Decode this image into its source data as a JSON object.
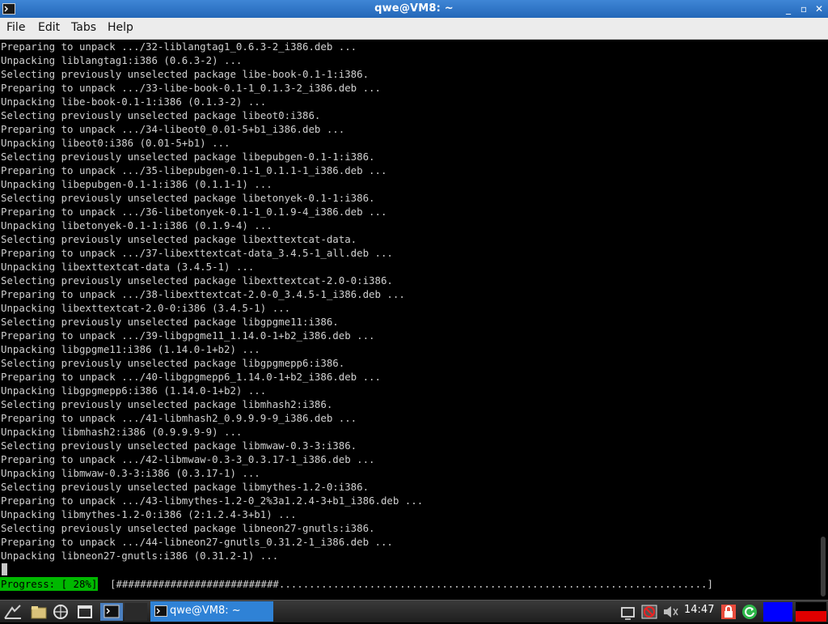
{
  "window": {
    "title": "qwe@VM8: ~",
    "controls": {
      "minimize": "_",
      "maximize": "▫",
      "close": "✕"
    }
  },
  "menu": [
    "File",
    "Edit",
    "Tabs",
    "Help"
  ],
  "terminal": {
    "lines": [
      "Preparing to unpack .../32-liblangtag1_0.6.3-2_i386.deb ...",
      "Unpacking liblangtag1:i386 (0.6.3-2) ...",
      "Selecting previously unselected package libe-book-0.1-1:i386.",
      "Preparing to unpack .../33-libe-book-0.1-1_0.1.3-2_i386.deb ...",
      "Unpacking libe-book-0.1-1:i386 (0.1.3-2) ...",
      "Selecting previously unselected package libeot0:i386.",
      "Preparing to unpack .../34-libeot0_0.01-5+b1_i386.deb ...",
      "Unpacking libeot0:i386 (0.01-5+b1) ...",
      "Selecting previously unselected package libepubgen-0.1-1:i386.",
      "Preparing to unpack .../35-libepubgen-0.1-1_0.1.1-1_i386.deb ...",
      "Unpacking libepubgen-0.1-1:i386 (0.1.1-1) ...",
      "Selecting previously unselected package libetonyek-0.1-1:i386.",
      "Preparing to unpack .../36-libetonyek-0.1-1_0.1.9-4_i386.deb ...",
      "Unpacking libetonyek-0.1-1:i386 (0.1.9-4) ...",
      "Selecting previously unselected package libexttextcat-data.",
      "Preparing to unpack .../37-libexttextcat-data_3.4.5-1_all.deb ...",
      "Unpacking libexttextcat-data (3.4.5-1) ...",
      "Selecting previously unselected package libexttextcat-2.0-0:i386.",
      "Preparing to unpack .../38-libexttextcat-2.0-0_3.4.5-1_i386.deb ...",
      "Unpacking libexttextcat-2.0-0:i386 (3.4.5-1) ...",
      "Selecting previously unselected package libgpgme11:i386.",
      "Preparing to unpack .../39-libgpgme11_1.14.0-1+b2_i386.deb ...",
      "Unpacking libgpgme11:i386 (1.14.0-1+b2) ...",
      "Selecting previously unselected package libgpgmepp6:i386.",
      "Preparing to unpack .../40-libgpgmepp6_1.14.0-1+b2_i386.deb ...",
      "Unpacking libgpgmepp6:i386 (1.14.0-1+b2) ...",
      "Selecting previously unselected package libmhash2:i386.",
      "Preparing to unpack .../41-libmhash2_0.9.9.9-9_i386.deb ...",
      "Unpacking libmhash2:i386 (0.9.9.9-9) ...",
      "Selecting previously unselected package libmwaw-0.3-3:i386.",
      "Preparing to unpack .../42-libmwaw-0.3-3_0.3.17-1_i386.deb ...",
      "Unpacking libmwaw-0.3-3:i386 (0.3.17-1) ...",
      "Selecting previously unselected package libmythes-1.2-0:i386.",
      "Preparing to unpack .../43-libmythes-1.2-0_2%3a1.2.4-3+b1_i386.deb ...",
      "Unpacking libmythes-1.2-0:i386 (2:1.2.4-3+b1) ...",
      "Selecting previously unselected package libneon27-gnutls:i386.",
      "Preparing to unpack .../44-libneon27-gnutls_0.31.2-1_i386.deb ...",
      "Unpacking libneon27-gnutls:i386 (0.31.2-1) ..."
    ],
    "progress_label": "Progress: [ 28%]",
    "progress_bar": "[###########################.......................................................................]",
    "progress_fraction": 0.28
  },
  "taskbar": {
    "active_task": "qwe@VM8: ~",
    "clock": "14:47"
  },
  "icons": {
    "app": "terminal-icon",
    "start": "start-menu-icon",
    "file_manager": "file-manager-icon",
    "browser": "web-browser-icon",
    "show_desktop": "show-desktop-icon",
    "terminal": "terminal-icon",
    "keyboard": "keyboard-icon",
    "network": "network-off-icon",
    "volume": "volume-muted-icon",
    "lock": "lock-icon",
    "update": "update-icon"
  },
  "colors": {
    "titlebar": "#2a6fc2",
    "progress_label_bg": "#00b800",
    "taskbar_active": "#2f82d6",
    "workspace_blue": "#0000ff",
    "workspace_red": "#e00000"
  }
}
